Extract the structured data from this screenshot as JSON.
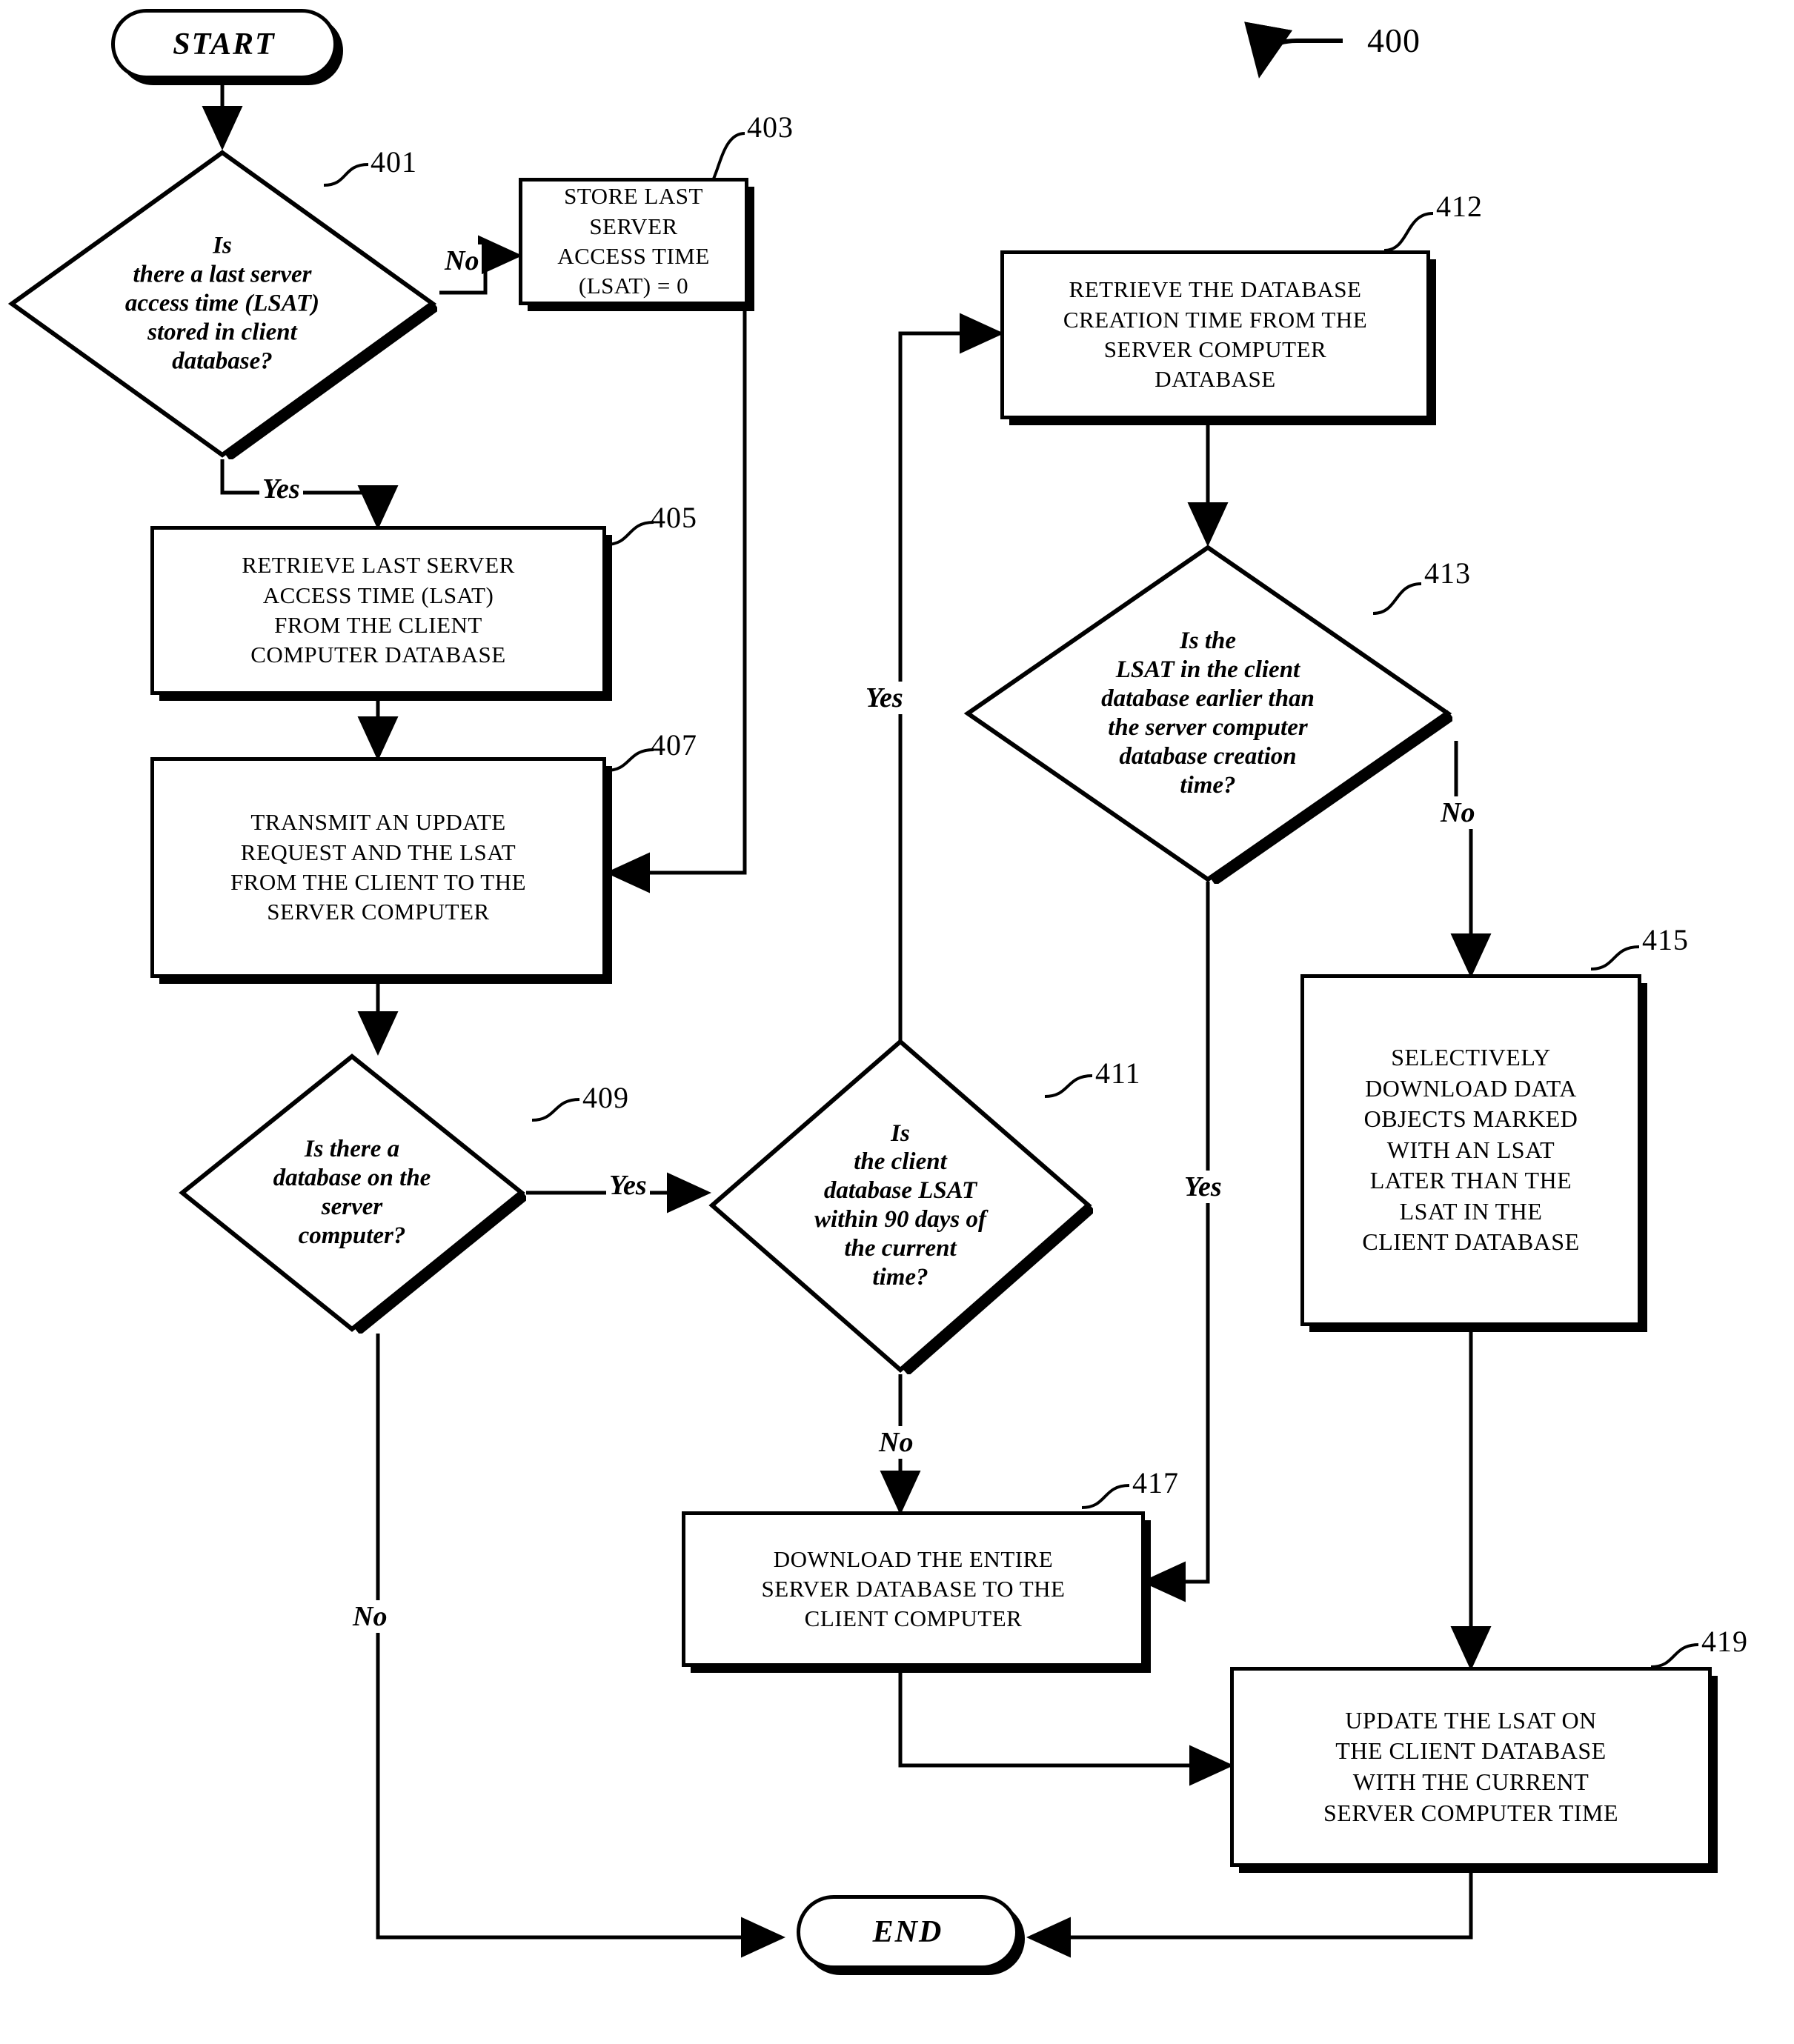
{
  "figure": {
    "number": "400"
  },
  "nodes": {
    "start": {
      "ref": "",
      "label": "START"
    },
    "end": {
      "ref": "",
      "label": "END"
    },
    "d401": {
      "ref": "401",
      "lines": [
        "Is",
        "there a last server",
        "access time (LSAT)",
        "stored in client",
        "database?"
      ]
    },
    "p403": {
      "ref": "403",
      "lines": [
        "STORE LAST SERVER",
        "ACCESS TIME (LSAT) = 0"
      ]
    },
    "p405": {
      "ref": "405",
      "lines": [
        "RETRIEVE LAST SERVER",
        "ACCESS TIME (LSAT)",
        "FROM THE CLIENT",
        "COMPUTER DATABASE"
      ]
    },
    "p407": {
      "ref": "407",
      "lines": [
        "TRANSMIT AN UPDATE",
        "REQUEST AND THE LSAT",
        "FROM THE CLIENT TO THE",
        "SERVER COMPUTER"
      ]
    },
    "d409": {
      "ref": "409",
      "lines": [
        "Is there a",
        "database on the",
        "server",
        "computer?"
      ]
    },
    "d411": {
      "ref": "411",
      "lines": [
        "Is",
        "the client",
        "database LSAT",
        "within 90 days of",
        "the current",
        "time?"
      ]
    },
    "p412": {
      "ref": "412",
      "lines": [
        "RETRIEVE THE DATABASE",
        "CREATION TIME FROM THE",
        "SERVER COMPUTER",
        "DATABASE"
      ]
    },
    "d413": {
      "ref": "413",
      "lines": [
        "Is the",
        "LSAT in the client",
        "database earlier than",
        "the server computer",
        "database creation",
        "time?"
      ]
    },
    "p415": {
      "ref": "415",
      "lines": [
        "SELECTIVELY",
        "DOWNLOAD DATA",
        "OBJECTS MARKED",
        "WITH AN LSAT",
        "LATER THAN THE",
        "LSAT IN THE",
        "CLIENT DATABASE"
      ]
    },
    "p417": {
      "ref": "417",
      "lines": [
        "DOWNLOAD THE ENTIRE",
        "SERVER DATABASE TO THE",
        "CLIENT COMPUTER"
      ]
    },
    "p419": {
      "ref": "419",
      "lines": [
        "UPDATE THE LSAT ON",
        "THE CLIENT DATABASE",
        "WITH THE CURRENT",
        "SERVER COMPUTER TIME"
      ]
    }
  },
  "edge_labels": {
    "d401_no": "No",
    "d401_yes": "Yes",
    "d409_yes": "Yes",
    "d409_no": "No",
    "d411_no": "No",
    "d411_yes": "Yes",
    "d413_no": "No",
    "d413_yes": "Yes"
  },
  "colors": {
    "ink": "#000000",
    "paper": "#ffffff"
  }
}
